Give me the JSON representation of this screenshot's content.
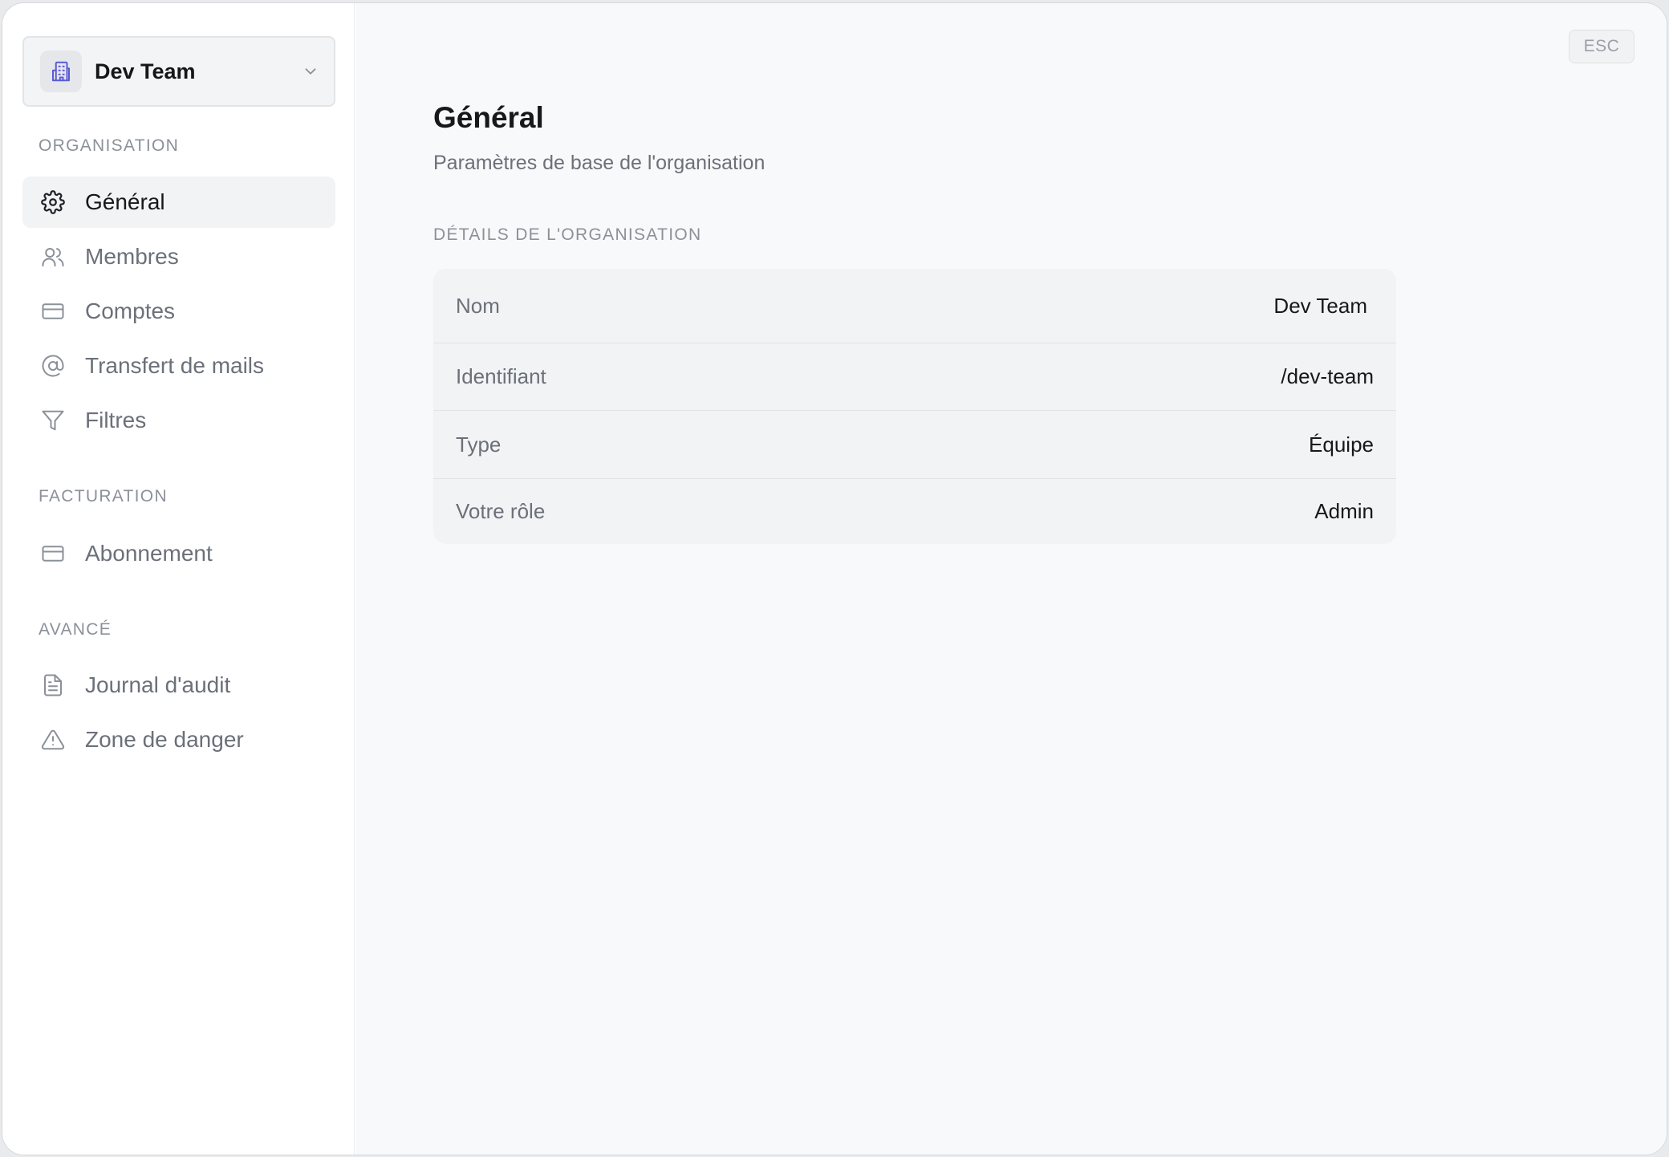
{
  "org_switcher": {
    "name": "Dev Team"
  },
  "sidebar": {
    "sections": [
      {
        "label": "ORGANISATION",
        "items": [
          {
            "label": "Général"
          },
          {
            "label": "Membres"
          },
          {
            "label": "Comptes"
          },
          {
            "label": "Transfert de mails"
          },
          {
            "label": "Filtres"
          }
        ]
      },
      {
        "label": "FACTURATION",
        "items": [
          {
            "label": "Abonnement"
          }
        ]
      },
      {
        "label": "AVANCÉ",
        "items": [
          {
            "label": "Journal d'audit"
          },
          {
            "label": "Zone de danger"
          }
        ]
      }
    ],
    "active_item": "Général"
  },
  "main": {
    "esc_label": "ESC",
    "title": "Général",
    "subtitle": "Paramètres de base de l'organisation",
    "details_label": "DÉTAILS DE L'ORGANISATION",
    "details": [
      {
        "key": "Nom",
        "value": "Dev Team"
      },
      {
        "key": "Identifiant",
        "value": "/dev-team"
      },
      {
        "key": "Type",
        "value": "Équipe"
      },
      {
        "key": "Votre rôle",
        "value": "Admin"
      }
    ]
  },
  "colors": {
    "accent_icon": "#5b5bd6",
    "active_item_bg": "#f2f3f5",
    "muted_text": "#6b7079"
  }
}
